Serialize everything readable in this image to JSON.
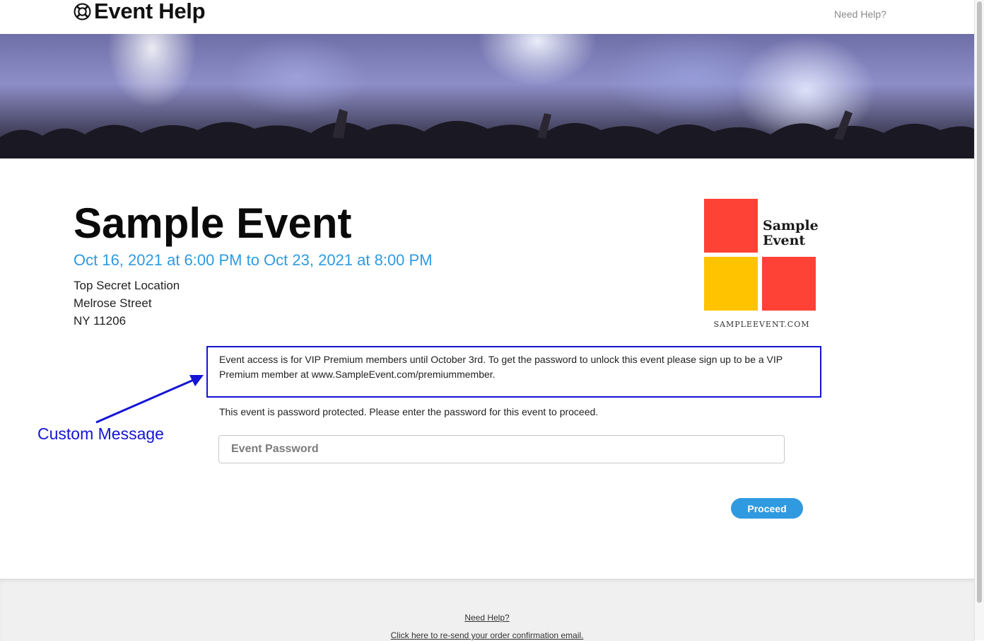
{
  "header": {
    "brand_name": "Event Help",
    "brand_icon": "lifebuoy-icon",
    "need_help": "Need Help?"
  },
  "event": {
    "title": "Sample Event",
    "dates": "Oct 16, 2021 at 6:00 PM to Oct 23, 2021 at 8:00 PM",
    "address": [
      "Top Secret Location",
      "Melrose Street",
      "NY 11206"
    ]
  },
  "logo": {
    "text_line1": "Sample",
    "text_line2": "Event",
    "url": "SAMPLEEVENT.COM",
    "colors": {
      "red": "#ff4136",
      "yellow": "#ffc300"
    }
  },
  "custom_message": {
    "text": "Event access is for VIP Premium members until October 3rd.  To get the password to unlock this event please sign up to be a VIP Premium member at www.SampleEvent.com/premiummember.",
    "annotation_label": "Custom Message",
    "annotation_color": "#1414d6"
  },
  "password_section": {
    "note": "This event is password protected. Please enter the password for this event to proceed.",
    "placeholder": "Event Password",
    "value": "",
    "proceed_label": "Proceed"
  },
  "footer": {
    "need_help": "Need Help?",
    "resend": "Click here to re-send your order confirmation email."
  },
  "colors": {
    "accent": "#2f9ae0",
    "annotation": "#1414d6"
  }
}
